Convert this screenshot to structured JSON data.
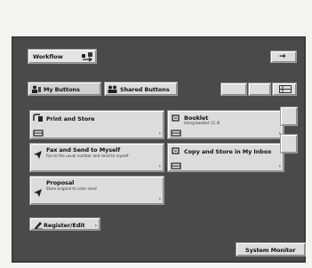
{
  "header": {
    "workflow_label": "Workflow",
    "next_arrow": "→"
  },
  "tabs": {
    "my_buttons": "My Buttons",
    "shared_buttons": "Shared Buttons"
  },
  "workflows": [
    {
      "title": "Print and Store",
      "desc": ""
    },
    {
      "title": "Booklet",
      "desc": "Using booklet 11 lll"
    },
    {
      "title": "Fax and Send to Myself",
      "desc": "Fax to the usual number and send to myself"
    },
    {
      "title": "Copy and Store in My Inbox",
      "desc": ""
    },
    {
      "title": "Proposal",
      "desc": "Store original to color send"
    }
  ],
  "register_edit": "Register/Edit",
  "status_monitor": "System Monitor",
  "colors": {
    "panel": "#4a4a4a",
    "button": "#dcdcdc"
  }
}
